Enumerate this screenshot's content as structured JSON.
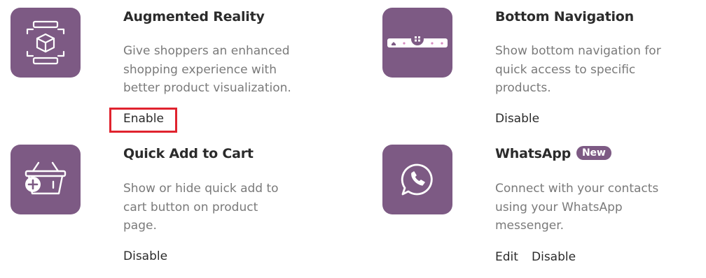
{
  "colors": {
    "tile": "#7d5a84",
    "highlight": "#e0232e",
    "title": "#2b2b2b",
    "desc": "#7a7a7a"
  },
  "features": {
    "ar": {
      "icon": "ar-cube-icon",
      "title": "Augmented Reality",
      "desc_lines": [
        "Give shoppers an enhanced",
        "shopping experience with",
        "better product visualization."
      ],
      "action": "Enable"
    },
    "bottom_nav": {
      "icon": "bottom-navigation-icon",
      "title": "Bottom Navigation",
      "desc_lines": [
        "Show bottom navigation for",
        "quick access to specific",
        "products."
      ],
      "action": "Disable"
    },
    "quick_add": {
      "icon": "add-to-basket-icon",
      "title": "Quick Add to Cart",
      "desc_lines": [
        "Show or hide quick add to",
        "cart button on product",
        "page."
      ],
      "action": "Disable"
    },
    "whatsapp": {
      "icon": "whatsapp-icon",
      "title": "WhatsApp",
      "badge": "New",
      "desc_lines": [
        "Connect with your contacts",
        "using your WhatsApp",
        "messenger."
      ],
      "edit": "Edit",
      "action": "Disable"
    }
  }
}
